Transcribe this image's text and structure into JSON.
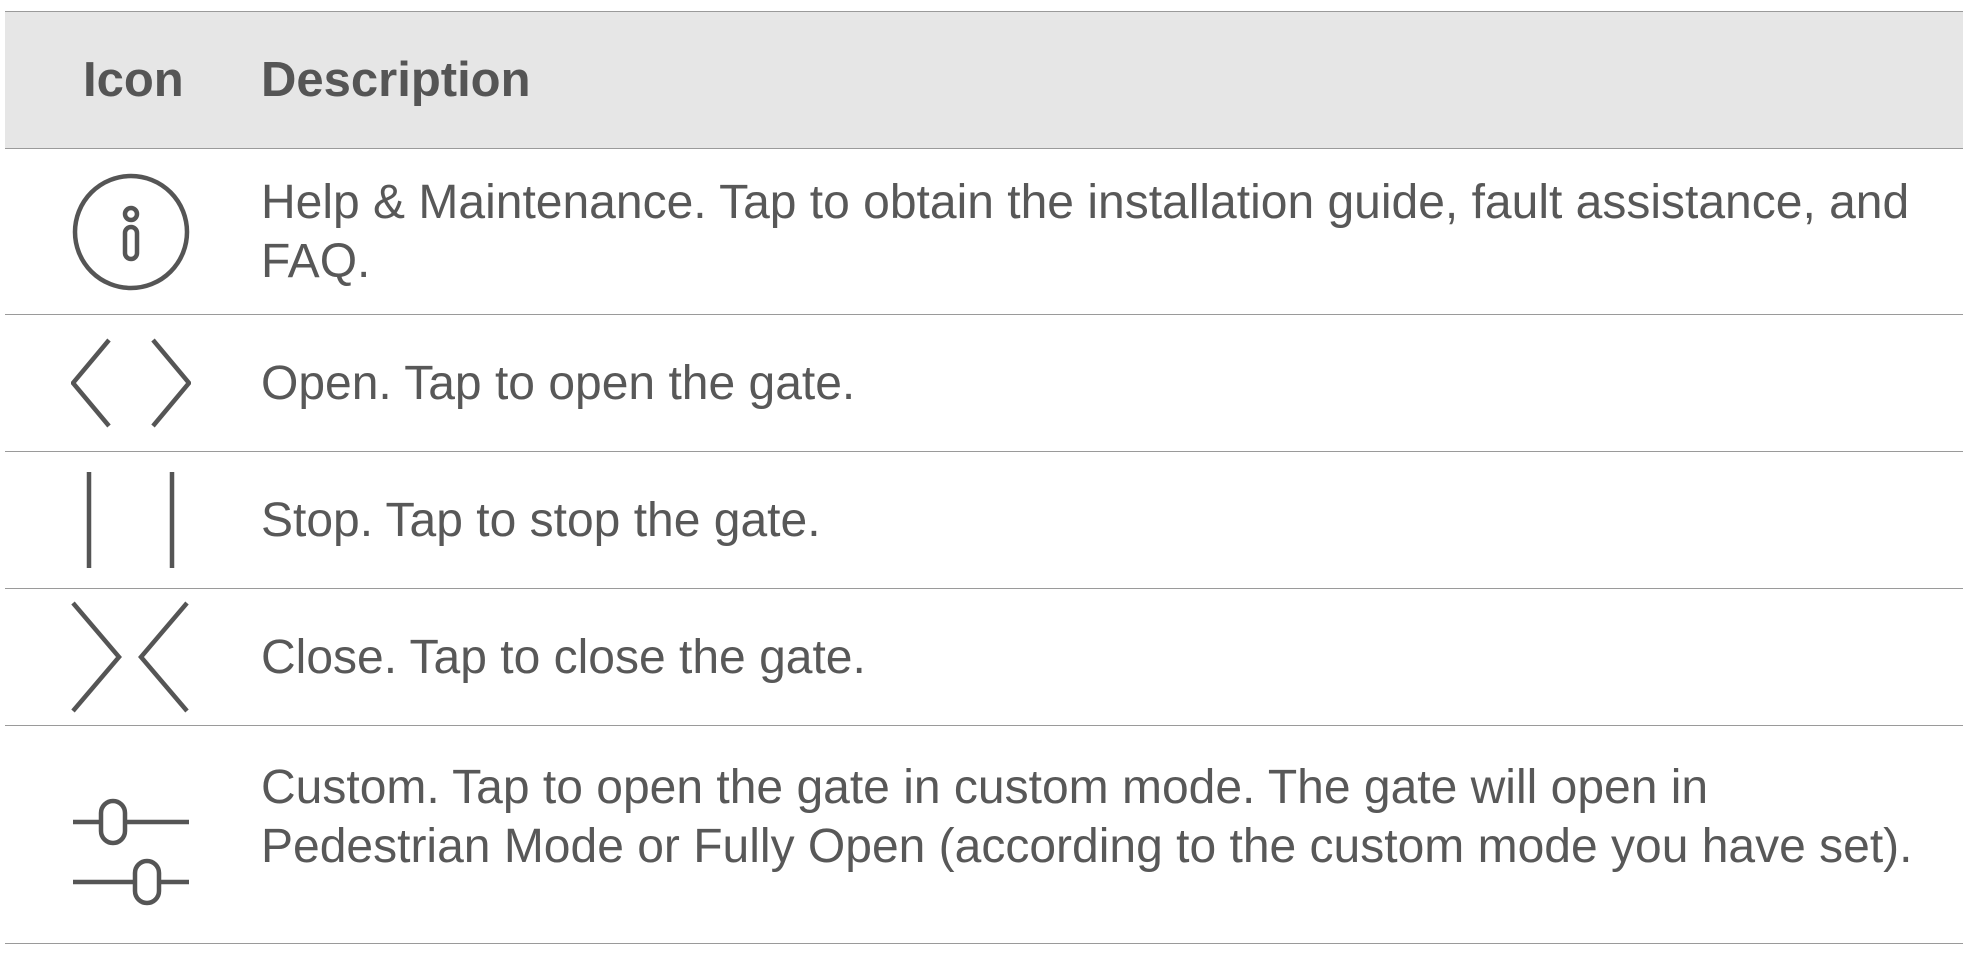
{
  "table": {
    "headers": {
      "icon": "Icon",
      "description": "Description"
    },
    "rows": [
      {
        "icon": "help-maintenance-icon",
        "description": "Help & Maintenance. Tap to obtain the installation guide, fault assistance, and FAQ."
      },
      {
        "icon": "open-icon",
        "description": "Open. Tap to open the gate."
      },
      {
        "icon": "stop-icon",
        "description": "Stop. Tap to stop the gate."
      },
      {
        "icon": "close-icon",
        "description": "Close. Tap to close the gate."
      },
      {
        "icon": "custom-mode-icon",
        "description": "Custom. Tap to open the gate in custom mode. The gate will open in Pedestrian Mode or Fully Open (according to the custom mode you have set)."
      }
    ]
  },
  "colors": {
    "text": "#585858",
    "header_background": "#e6e6e6",
    "rule": "#9a9a9a",
    "icon_stroke": "#555555"
  }
}
